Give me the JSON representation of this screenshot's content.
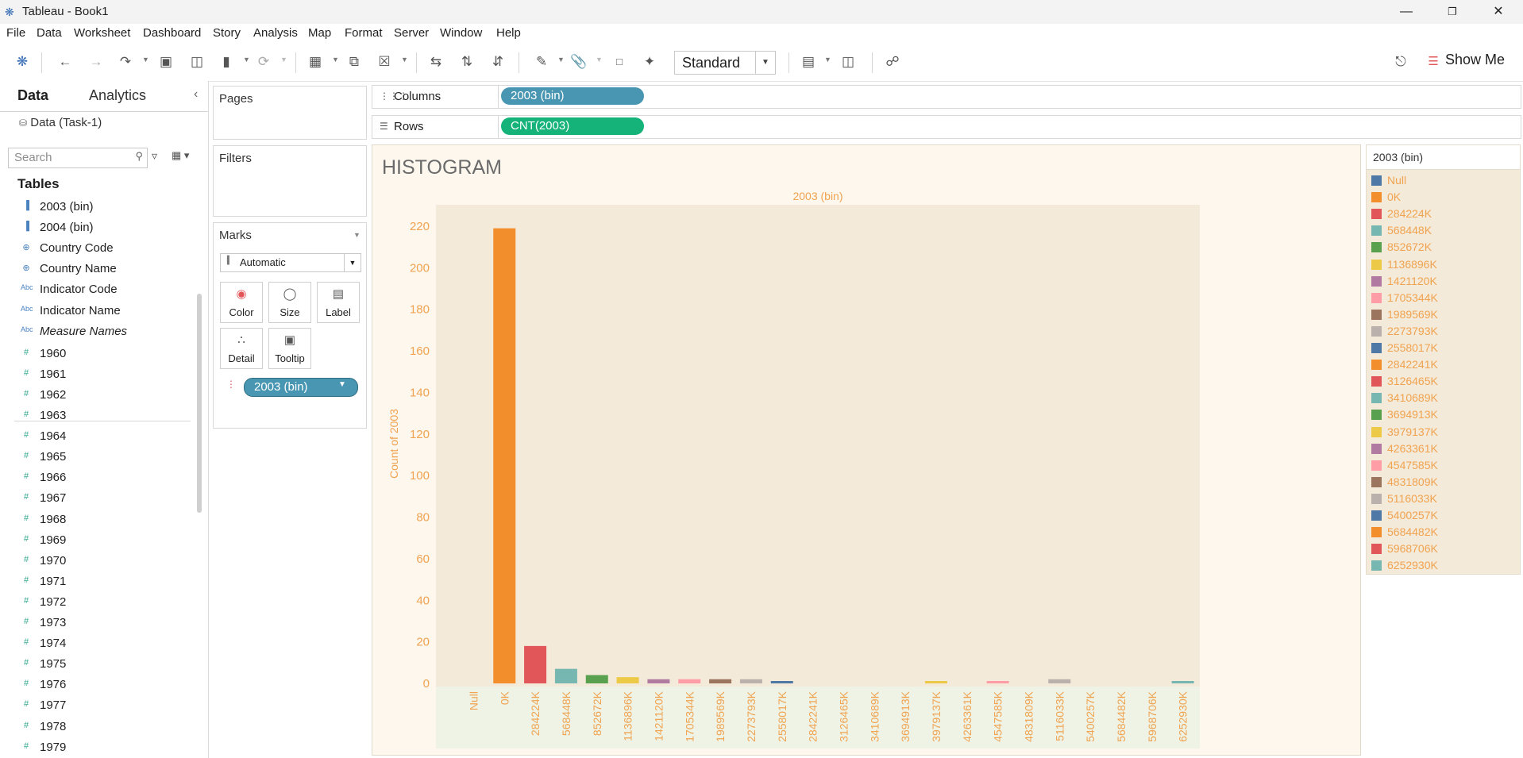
{
  "titlebar": {
    "title": "Tableau - Book1",
    "min": "—",
    "restore": "❐",
    "close": "✕"
  },
  "menu": [
    "File",
    "Data",
    "Worksheet",
    "Dashboard",
    "Story",
    "Analysis",
    "Map",
    "Format",
    "Server",
    "Window",
    "Help"
  ],
  "toolbar": {
    "fit": "Standard",
    "showme": "Show Me"
  },
  "datapane": {
    "tab_data": "Data",
    "tab_analytics": "Analytics",
    "source": "Data (Task-1)",
    "search_placeholder": "Search",
    "tables_heading": "Tables",
    "fields": [
      {
        "icon": "bin",
        "label": "2003 (bin)"
      },
      {
        "icon": "bin",
        "label": "2004 (bin)"
      },
      {
        "icon": "geo",
        "label": "Country Code"
      },
      {
        "icon": "geo",
        "label": "Country Name"
      },
      {
        "icon": "abc",
        "label": "Indicator Code"
      },
      {
        "icon": "abc",
        "label": "Indicator Name"
      },
      {
        "icon": "abc",
        "label": "Measure Names"
      },
      {
        "icon": "num",
        "label": "1960"
      },
      {
        "icon": "num",
        "label": "1961"
      },
      {
        "icon": "num",
        "label": "1962"
      },
      {
        "icon": "num",
        "label": "1963"
      },
      {
        "icon": "num",
        "label": "1964"
      },
      {
        "icon": "num",
        "label": "1965"
      },
      {
        "icon": "num",
        "label": "1966"
      },
      {
        "icon": "num",
        "label": "1967"
      },
      {
        "icon": "num",
        "label": "1968"
      },
      {
        "icon": "num",
        "label": "1969"
      },
      {
        "icon": "num",
        "label": "1970"
      },
      {
        "icon": "num",
        "label": "1971"
      },
      {
        "icon": "num",
        "label": "1972"
      },
      {
        "icon": "num",
        "label": "1973"
      },
      {
        "icon": "num",
        "label": "1974"
      },
      {
        "icon": "num",
        "label": "1975"
      },
      {
        "icon": "num",
        "label": "1976"
      },
      {
        "icon": "num",
        "label": "1977"
      },
      {
        "icon": "num",
        "label": "1978"
      },
      {
        "icon": "num",
        "label": "1979"
      }
    ]
  },
  "cards": {
    "pages": "Pages",
    "filters": "Filters",
    "marks": "Marks",
    "mark_type": "Automatic",
    "buttons": [
      "Color",
      "Size",
      "Label",
      "Detail",
      "Tooltip"
    ],
    "marks_pill": "2003 (bin)"
  },
  "shelves": {
    "columns_label": "Columns",
    "columns_pill": "2003 (bin)",
    "rows_label": "Rows",
    "rows_pill": "CNT(2003)"
  },
  "colors": {
    "columns_pill": "#4996b2",
    "rows_pill": "#15b37a",
    "axis_text": "#f0a350"
  },
  "view": {
    "sheet_title": "HISTOGRAM"
  },
  "chart_data": {
    "type": "bar",
    "title": "2003 (bin)",
    "xlabel": "2003 (bin)",
    "ylabel": "Count of 2003",
    "ylim": [
      0,
      230
    ],
    "yticks": [
      0,
      20,
      40,
      60,
      80,
      100,
      120,
      140,
      160,
      180,
      200,
      220
    ],
    "grid": false,
    "categories": [
      "Null",
      "0K",
      "284224K",
      "568448K",
      "852672K",
      "1136896K",
      "1421120K",
      "1705344K",
      "1989569K",
      "2273793K",
      "2558017K",
      "2842241K",
      "3126465K",
      "3410689K",
      "3694913K",
      "3979137K",
      "4263361K",
      "4547585K",
      "4831809K",
      "5116033K",
      "5400257K",
      "5684482K",
      "5968706K",
      "6252930K"
    ],
    "values": [
      0,
      219,
      18,
      7,
      4,
      3,
      2,
      2,
      2,
      2,
      1,
      0,
      0,
      0,
      0,
      1,
      0,
      1,
      0,
      2,
      0,
      0,
      0,
      1
    ],
    "colors": [
      "#4e79a7",
      "#f28e2b",
      "#e15759",
      "#76b7b2",
      "#59a14f",
      "#edc948",
      "#b07aa1",
      "#ff9da7",
      "#9c755f",
      "#bab0ac",
      "#4e79a7",
      "#f28e2b",
      "#e15759",
      "#76b7b2",
      "#59a14f",
      "#edc948",
      "#b07aa1",
      "#ff9da7",
      "#9c755f",
      "#bab0ac",
      "#4e79a7",
      "#f28e2b",
      "#e15759",
      "#76b7b2"
    ]
  },
  "legend": {
    "title": "2003 (bin)",
    "items": [
      "Null",
      "0K",
      "284224K",
      "568448K",
      "852672K",
      "1136896K",
      "1421120K",
      "1705344K",
      "1989569K",
      "2273793K",
      "2558017K",
      "2842241K",
      "3126465K",
      "3410689K",
      "3694913K",
      "3979137K",
      "4263361K",
      "4547585K",
      "4831809K",
      "5116033K",
      "5400257K",
      "5684482K",
      "5968706K",
      "6252930K"
    ]
  }
}
